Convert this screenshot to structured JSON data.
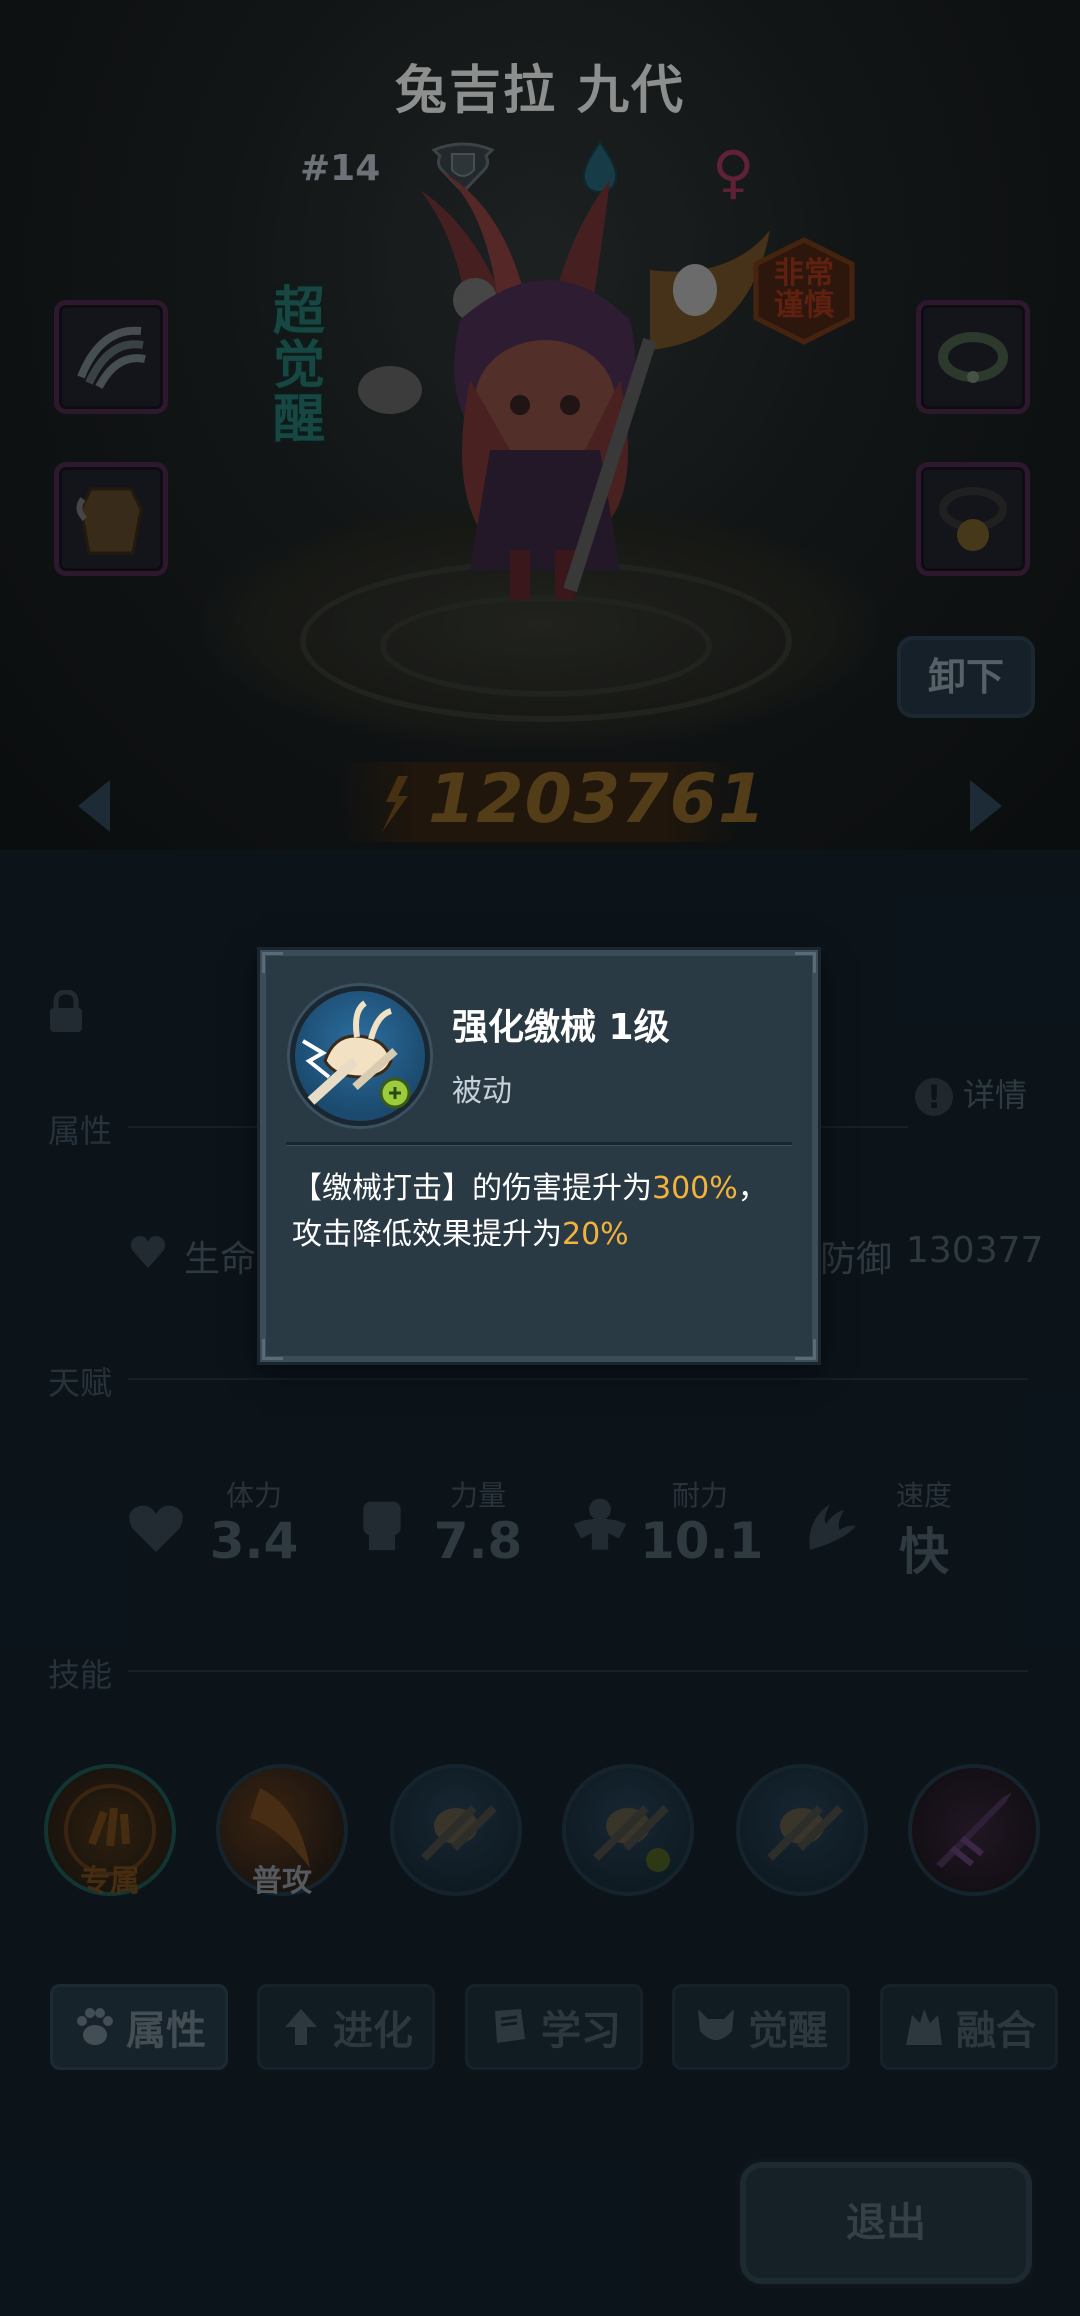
{
  "hero": {
    "name": "兔吉拉 九代",
    "rank": "#14",
    "super_awakened_label": "超觉醒",
    "trait_badge": [
      "非常",
      "谨慎"
    ],
    "power": "1203761"
  },
  "buttons": {
    "unequip": "卸下",
    "exit": "退出",
    "details": "详情"
  },
  "sections": {
    "attributes": "属性",
    "talent": "天赋",
    "skills": "技能"
  },
  "stats": {
    "hp_label": "生命",
    "defense_label": "防御",
    "defense_value": "130377"
  },
  "talents": [
    {
      "label": "体力",
      "value": "3.4",
      "icon": "heart-icon"
    },
    {
      "label": "力量",
      "value": "7.8",
      "icon": "fist-icon"
    },
    {
      "label": "耐力",
      "value": "10.1",
      "icon": "muscle-icon"
    },
    {
      "label": "速度",
      "value": "快",
      "icon": "wing-icon"
    }
  ],
  "skills": [
    {
      "label": "专属",
      "icon": "exclusive-skill-icon",
      "label_color": "#5a3a16"
    },
    {
      "label": "普攻",
      "icon": "basic-attack-icon",
      "label_color": "#6c747a"
    },
    {
      "label": "",
      "icon": "cable-strike-icon"
    },
    {
      "label": "",
      "icon": "cable-strike-upgrade-icon"
    },
    {
      "label": "",
      "icon": "cable-strike-alt-icon"
    },
    {
      "label": "",
      "icon": "purple-spike-icon"
    }
  ],
  "tabs": [
    {
      "label": "属性",
      "icon": "paw-icon",
      "active": true
    },
    {
      "label": "进化",
      "icon": "evolve-icon",
      "active": false
    },
    {
      "label": "学习",
      "icon": "book-icon",
      "active": false
    },
    {
      "label": "觉醒",
      "icon": "demon-icon",
      "active": false
    },
    {
      "label": "融合",
      "icon": "fusion-icon",
      "active": false
    }
  ],
  "popup": {
    "title": "强化缴械 1级",
    "type": "被动",
    "desc_part1": "【缴械打击】的伤害提升为",
    "desc_hl1": "300%",
    "desc_part2": "，",
    "desc_part3": "攻击降低效果提升为",
    "desc_hl2": "20%"
  },
  "colors": {
    "highlight": "#f2b23c",
    "popup_bg": "#2a3a44",
    "background": "#101a22"
  }
}
